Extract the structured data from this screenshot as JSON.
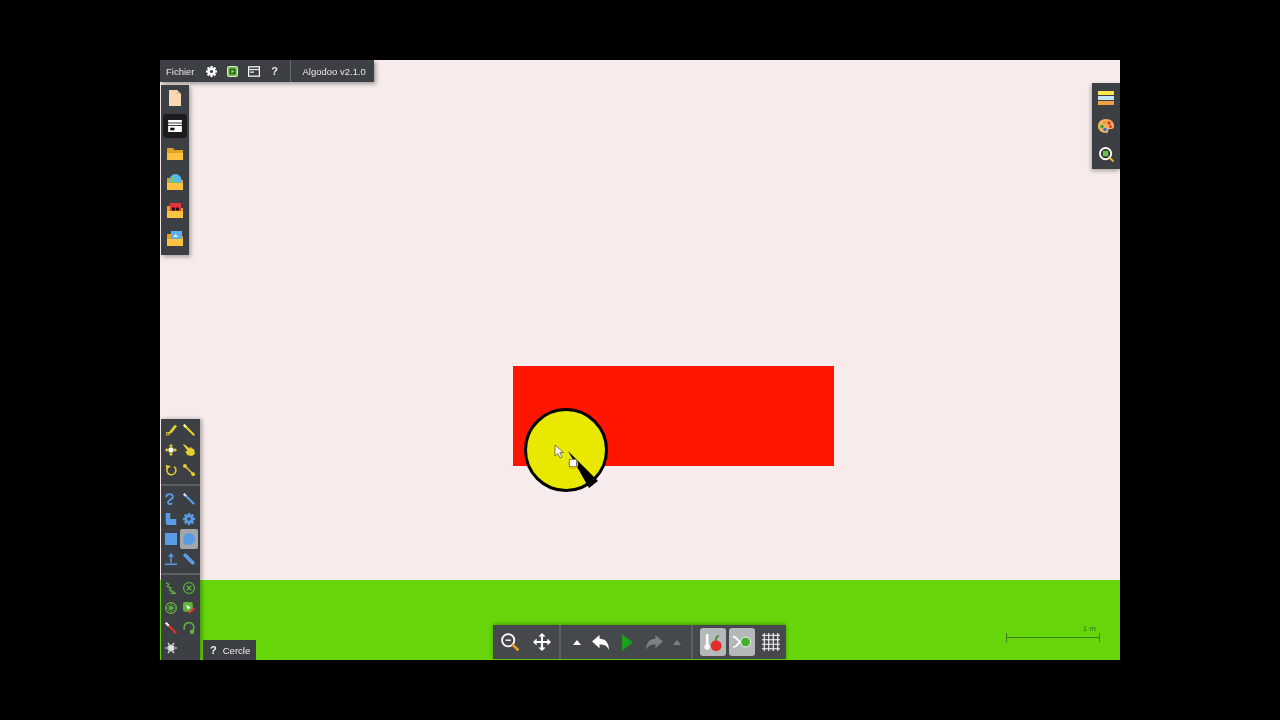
{
  "menu_bar": {
    "file_menu": "Fichier",
    "help": "?",
    "version": "Algodoo v2.1.0"
  },
  "file_toolbar": [
    {
      "kind": "new",
      "selected": false
    },
    {
      "kind": "card",
      "selected": true
    },
    {
      "kind": "folder",
      "selected": false
    },
    {
      "kind": "globe_folder",
      "selected": false
    },
    {
      "kind": "sticker_folder",
      "selected": false
    },
    {
      "kind": "picture_folder",
      "selected": false
    }
  ],
  "tool_palette": {
    "groups": [
      {
        "tools": [
          {
            "kind": "sketch",
            "selected": false
          },
          {
            "kind": "knife",
            "selected": false
          },
          {
            "kind": "move",
            "selected": false
          },
          {
            "kind": "drag",
            "selected": false
          },
          {
            "kind": "rotate",
            "selected": false
          },
          {
            "kind": "scale",
            "selected": false
          }
        ]
      },
      {
        "tools": [
          {
            "kind": "rope",
            "selected": false
          },
          {
            "kind": "brush",
            "selected": false
          },
          {
            "kind": "polygon",
            "selected": false
          },
          {
            "kind": "gear",
            "selected": false
          },
          {
            "kind": "box",
            "selected": false
          },
          {
            "kind": "circle",
            "selected": true
          },
          {
            "kind": "plane",
            "selected": false
          },
          {
            "kind": "chain",
            "selected": false
          }
        ]
      },
      {
        "tools": [
          {
            "kind": "spring",
            "selected": false
          },
          {
            "kind": "fixate",
            "selected": false
          },
          {
            "kind": "axle",
            "selected": false
          },
          {
            "kind": "tracer",
            "selected": false
          },
          {
            "kind": "laser",
            "selected": false
          },
          {
            "kind": "thruster",
            "selected": false
          },
          {
            "kind": "texture",
            "selected": false
          }
        ]
      }
    ]
  },
  "tooltip": {
    "help_mark": "?",
    "text": "Cercle"
  },
  "bottom_toolbar": {
    "history": [
      {
        "kind": "undo_list",
        "disabled": false
      },
      {
        "kind": "undo",
        "disabled": false
      },
      {
        "kind": "play",
        "disabled": false
      },
      {
        "kind": "redo",
        "disabled": true
      },
      {
        "kind": "redo_list",
        "disabled": true
      }
    ],
    "toggles": [
      {
        "kind": "gravity",
        "on": true
      },
      {
        "kind": "air_friction",
        "on": true
      },
      {
        "kind": "grid",
        "on": false
      }
    ]
  },
  "scale_bar": {
    "label": "1 m"
  },
  "scene": {
    "shapes": [
      {
        "kind": "box",
        "color": "#ff1500"
      },
      {
        "kind": "circle",
        "color": "#e8e800"
      }
    ]
  }
}
